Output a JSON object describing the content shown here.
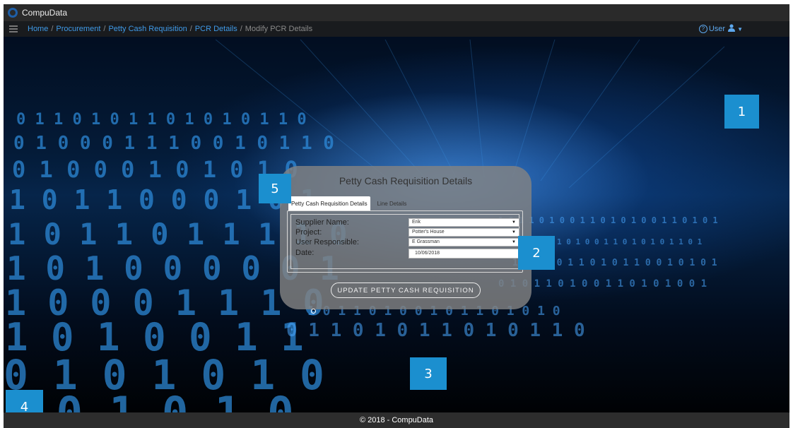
{
  "app": {
    "title": "CompuData"
  },
  "breadcrumb": {
    "items": [
      "Home",
      "Procurement",
      "Petty Cash Requisition",
      "PCR Details"
    ],
    "current": "Modify PCR Details",
    "separator": "/"
  },
  "user_menu": {
    "help_icon": "?",
    "label": "User",
    "person_icon": "person-icon",
    "caret_icon": "caret-down-icon"
  },
  "panel": {
    "title": "Petty Cash Requisition Details",
    "tabs": [
      {
        "label": "Petty Cash Requisition Details",
        "active": true
      },
      {
        "label": "Line Details",
        "active": false
      }
    ],
    "fields": [
      {
        "label": "Supplier Name:",
        "value": "Erik",
        "type": "select"
      },
      {
        "label": "Project:",
        "value": "Potter's House",
        "type": "select"
      },
      {
        "label": "User Responsible:",
        "value": "E Grassman",
        "type": "select"
      },
      {
        "label": "Date:",
        "value": "10/06/2018",
        "type": "date"
      }
    ],
    "update_button": "UPDATE PETTY CASH REQUISITION"
  },
  "markers": [
    "1",
    "2",
    "3",
    "4",
    "5"
  ],
  "footer": {
    "text": "© 2018 - CompuData"
  },
  "colors": {
    "accent": "#1b8fcf",
    "link": "#3f9ae8",
    "topbar": "#2a2a2a",
    "footer": "#2d2d2d"
  }
}
